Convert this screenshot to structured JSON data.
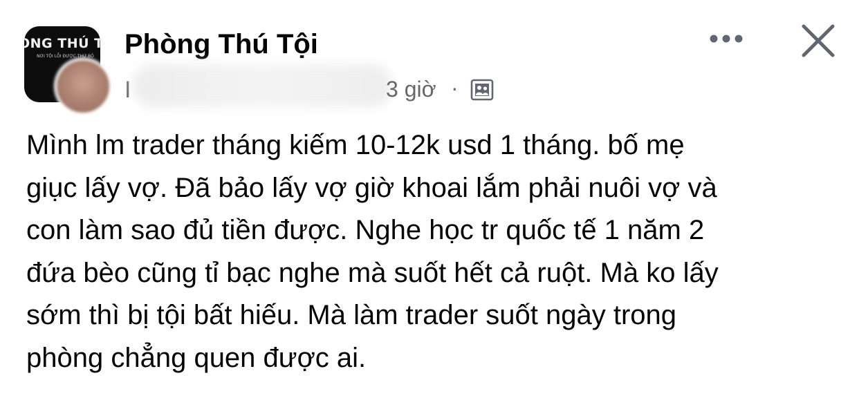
{
  "post": {
    "group_name": "Phòng Thú Tội",
    "group_avatar": {
      "title": "ÒNG THÚ T",
      "subtitle": "NƠI TỘI LỖI ĐƯỢC THỨ BỎ"
    },
    "author_initial": "I",
    "time": "3 giờ",
    "separator": "·",
    "audience_icon": "group-audience-icon",
    "actions": {
      "more_icon": "more-horizontal-icon",
      "close_icon": "close-icon"
    },
    "text_lines": [
      "Mình lm trader tháng kiếm 10-12k usd 1 tháng. bố mẹ",
      "giục lấy vợ. Đã bảo lấy vợ giờ khoai lắm phải nuôi vợ và",
      "con làm sao đủ tiền được. Nghe học tr quốc tế 1 năm 2",
      "đứa bèo cũng tỉ bạc nghe mà suốt hết cả ruột. Mà ko lấy",
      "sớm thì bị tội bất hiếu. Mà làm trader suốt ngày trong",
      "phòng chẳng quen được ai."
    ]
  },
  "colors": {
    "text": "#050505",
    "secondary_text": "#65676b",
    "icon": "#606770",
    "background": "#ffffff"
  }
}
